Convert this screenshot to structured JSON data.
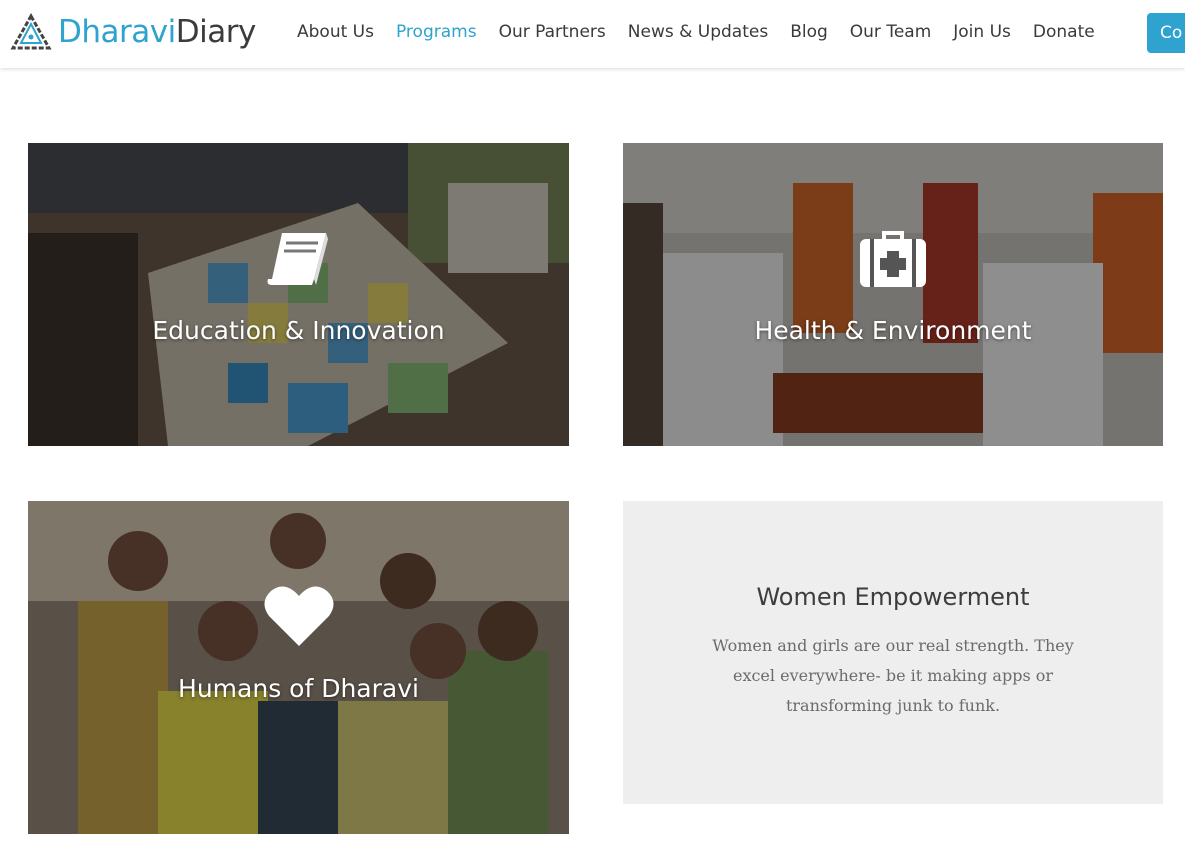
{
  "brand": {
    "name_part1": "Dharavi",
    "name_part2": "Diary",
    "accent": "#2fa3cf"
  },
  "nav": {
    "items": [
      {
        "label": "About Us",
        "active": false
      },
      {
        "label": "Programs",
        "active": true
      },
      {
        "label": "Our Partners",
        "active": false
      },
      {
        "label": "News & Updates",
        "active": false
      },
      {
        "label": "Blog",
        "active": false
      },
      {
        "label": "Our Team",
        "active": false
      },
      {
        "label": "Join Us",
        "active": false
      },
      {
        "label": "Donate",
        "active": false
      }
    ],
    "cta_label": "Co"
  },
  "programs": {
    "education": {
      "label": "Education & Innovation",
      "icon": "book-icon"
    },
    "health": {
      "label": "Health & Environment",
      "icon": "medical-kit-icon"
    },
    "humans": {
      "label": "Humans of Dharavi",
      "icon": "heart-icon"
    },
    "women": {
      "title": "Women Empowerment",
      "description": "Women and girls are our real strength. They excel everywhere- be it making apps or transforming junk to funk."
    }
  }
}
